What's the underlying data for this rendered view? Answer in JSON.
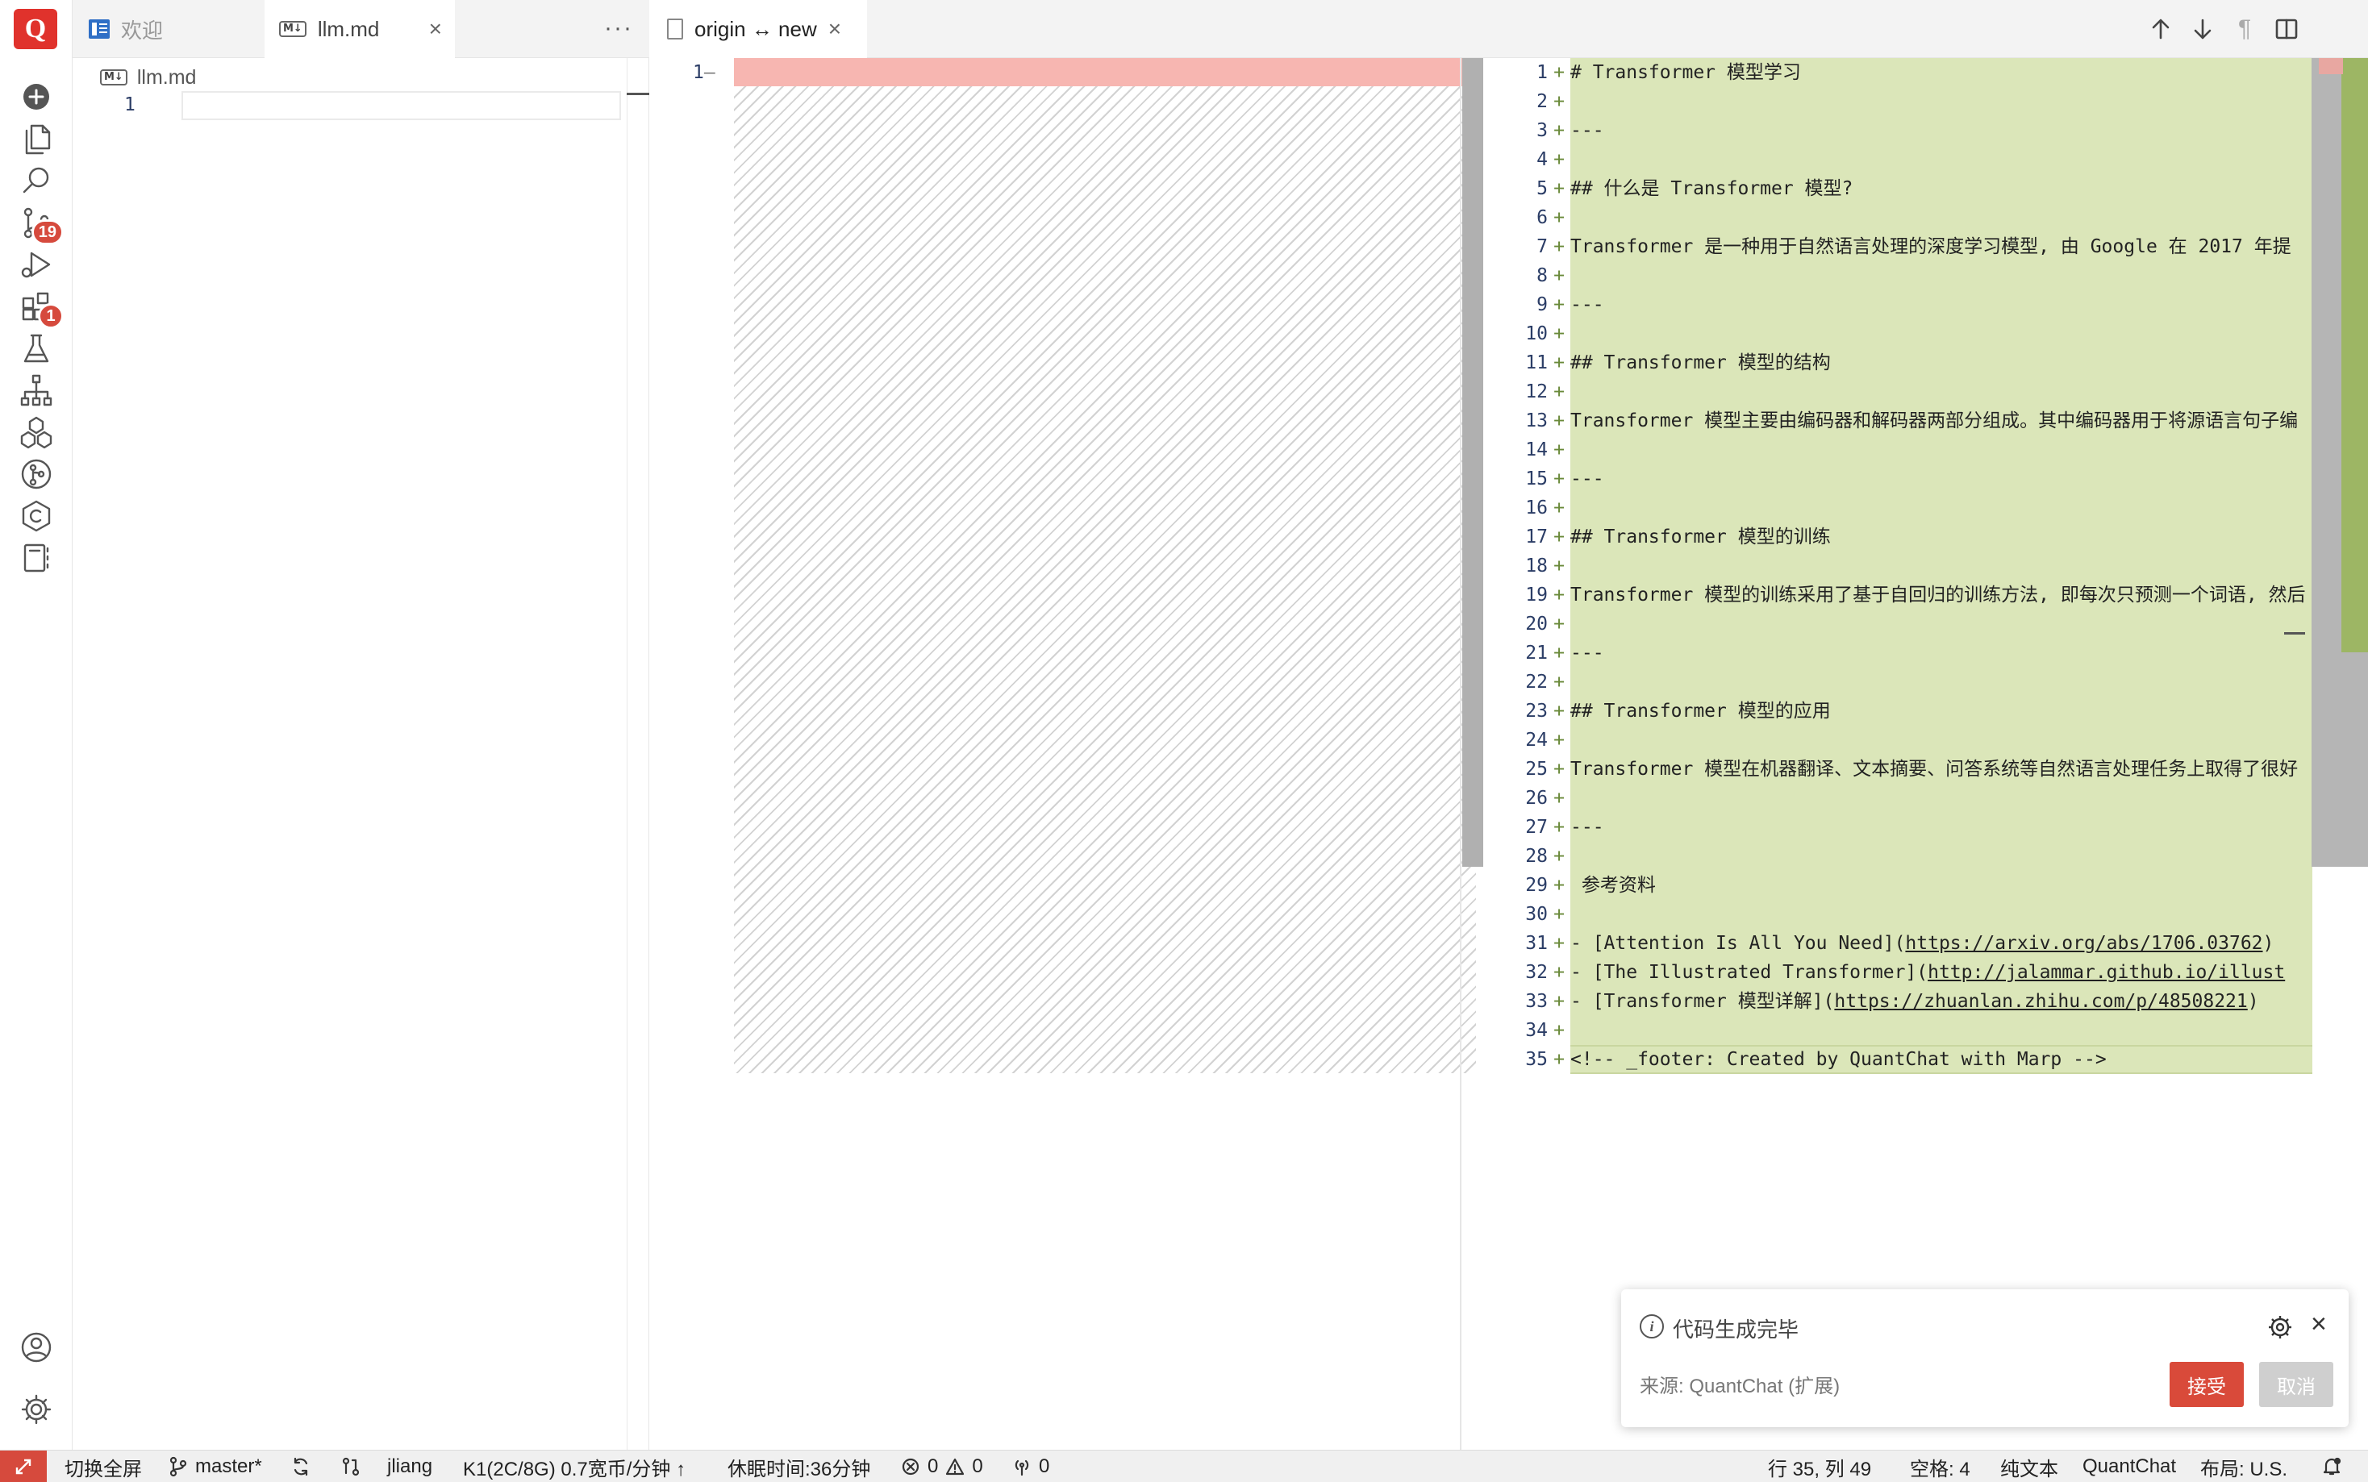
{
  "app": {
    "logo_letter": "Q"
  },
  "activity_bar": {
    "items": [
      {
        "icon": "plus-circle-icon"
      },
      {
        "icon": "files-icon"
      },
      {
        "icon": "search-icon"
      },
      {
        "icon": "source-control-icon",
        "badge": "19"
      },
      {
        "icon": "run-debug-icon"
      },
      {
        "icon": "extensions-icon",
        "badge": "1"
      },
      {
        "icon": "flask-icon"
      },
      {
        "icon": "hierarchy-icon"
      },
      {
        "icon": "cubes-icon"
      },
      {
        "icon": "git-graph-icon"
      },
      {
        "icon": "copyright-hexagon-icon"
      },
      {
        "icon": "notebook-icon"
      },
      {
        "icon": "account-icon"
      },
      {
        "icon": "settings-gear-icon"
      }
    ]
  },
  "left_group": {
    "tabs": [
      {
        "label": "欢迎",
        "active": false
      },
      {
        "label": "llm.md",
        "active": true
      }
    ],
    "more": "···",
    "breadcrumb": "llm.md",
    "line_number": "1"
  },
  "diff": {
    "tab_title": "origin ↔ new",
    "toolbar": [
      "arrow-up-icon",
      "arrow-down-icon",
      "pilcrow-icon",
      "split-editor-icon"
    ],
    "original": {
      "line_numbers": [
        "1"
      ],
      "markers": [
        "—"
      ]
    },
    "modified_lines": [
      {
        "n": "1",
        "text": "# Transformer 模型学习"
      },
      {
        "n": "2",
        "text": ""
      },
      {
        "n": "3",
        "text": "---"
      },
      {
        "n": "4",
        "text": ""
      },
      {
        "n": "5",
        "text": "## 什么是 Transformer 模型?"
      },
      {
        "n": "6",
        "text": ""
      },
      {
        "n": "7",
        "text": "Transformer 是一种用于自然语言处理的深度学习模型, 由 Google 在 2017 年提"
      },
      {
        "n": "8",
        "text": ""
      },
      {
        "n": "9",
        "text": "---"
      },
      {
        "n": "10",
        "text": ""
      },
      {
        "n": "11",
        "text": "## Transformer 模型的结构"
      },
      {
        "n": "12",
        "text": ""
      },
      {
        "n": "13",
        "text": "Transformer 模型主要由编码器和解码器两部分组成。其中编码器用于将源语言句子编"
      },
      {
        "n": "14",
        "text": ""
      },
      {
        "n": "15",
        "text": "---"
      },
      {
        "n": "16",
        "text": ""
      },
      {
        "n": "17",
        "text": "## Transformer 模型的训练"
      },
      {
        "n": "18",
        "text": ""
      },
      {
        "n": "19",
        "text": "Transformer 模型的训练采用了基于自回归的训练方法, 即每次只预测一个词语, 然后"
      },
      {
        "n": "20",
        "text": ""
      },
      {
        "n": "21",
        "text": "---"
      },
      {
        "n": "22",
        "text": ""
      },
      {
        "n": "23",
        "text": "## Transformer 模型的应用"
      },
      {
        "n": "24",
        "text": ""
      },
      {
        "n": "25",
        "text": "Transformer 模型在机器翻译、文本摘要、问答系统等自然语言处理任务上取得了很好"
      },
      {
        "n": "26",
        "text": ""
      },
      {
        "n": "27",
        "text": "---"
      },
      {
        "n": "28",
        "text": ""
      },
      {
        "n": "29",
        "text": " 参考资料"
      },
      {
        "n": "30",
        "text": ""
      },
      {
        "n": "31",
        "text": "- [Attention Is All You Need](",
        "link": "https://arxiv.org/abs/1706.03762",
        "after": ")"
      },
      {
        "n": "32",
        "text": "- [The Illustrated Transformer](",
        "link": "http://jalammar.github.io/illust",
        "after": ""
      },
      {
        "n": "33",
        "text": "- [Transformer 模型详解](",
        "link": "https://zhuanlan.zhihu.com/p/48508221",
        "after": ")"
      },
      {
        "n": "34",
        "text": ""
      },
      {
        "n": "35",
        "text": "<!-- _footer: Created by QuantChat with Marp -->"
      }
    ],
    "plus_marker": "+"
  },
  "notification": {
    "message": "代码生成完毕",
    "source": "来源: QuantChat (扩展)",
    "accept_label": "接受",
    "cancel_label": "取消"
  },
  "status_bar": {
    "fullscreen": "切换全屏",
    "branch": "master*",
    "user": "jliang",
    "resources": "K1(2C/8G) 0.7宽币/分钟 ↑",
    "sleep": "休眠时间:36分钟",
    "errors": "0",
    "warnings": "0",
    "ports": "0",
    "cursor": "行 35, 列 49",
    "spaces": "空格: 4",
    "language": "纯文本",
    "extension": "QuantChat",
    "layout": "布局: U.S."
  },
  "colors": {
    "brand": "#e0322c",
    "deleted_bg": "#f7b6b1",
    "inserted_bg": "#dbe6b9",
    "accept_button": "#d94a3a"
  }
}
